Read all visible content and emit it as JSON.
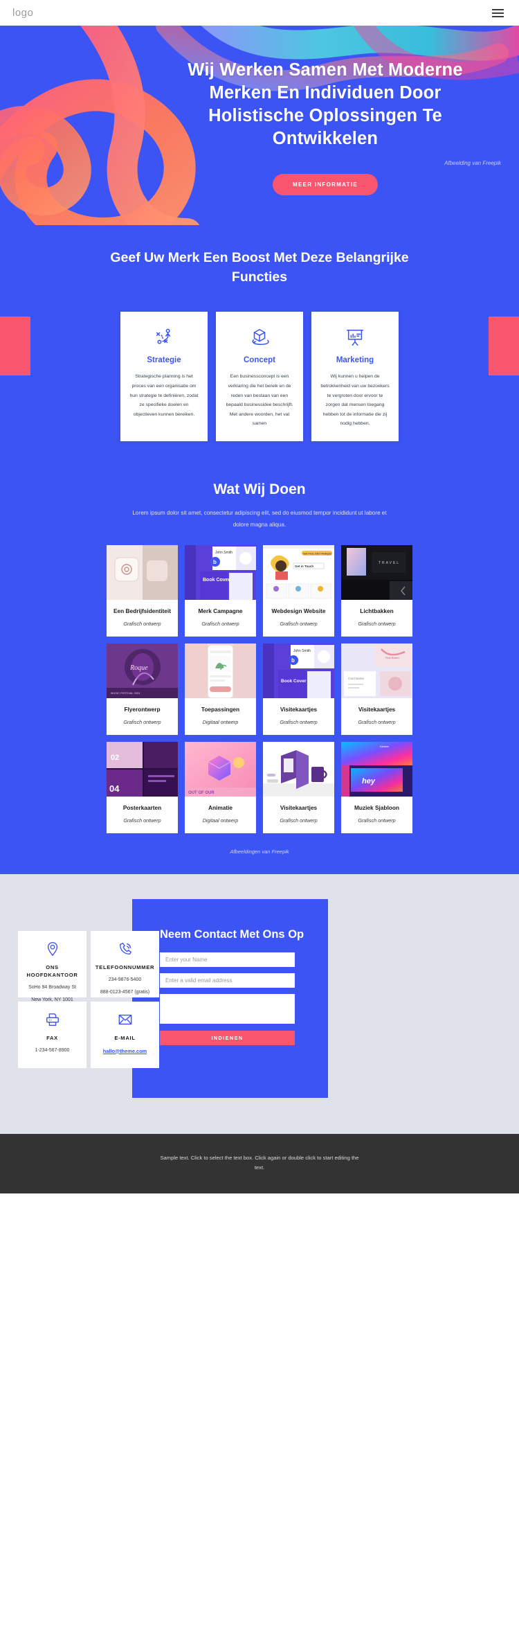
{
  "header": {
    "logo": "logo",
    "menu_icon": "hamburger-menu-icon"
  },
  "hero": {
    "title": "Wij Werken Samen Met Moderne Merken En Individuen Door Holistische Oplossingen Te Ontwikkelen",
    "credit": "Afbeelding van Freepik",
    "cta": "MEER INFORMATIE",
    "bg_color": "#3d54f4",
    "accent_color": "#f8566f"
  },
  "features": {
    "title": "Geef Uw Merk Een Boost Met Deze Belangrijke Functies",
    "cards": [
      {
        "icon": "strategy-icon",
        "name": "Strategie",
        "desc": "Strategische planning is het proces van een organisatie om hun strategie te definiëren, zodat ze specifieke doelen en objectieven kunnen bereiken."
      },
      {
        "icon": "concept-cube-icon",
        "name": "Concept",
        "desc": "Een businessconcept is een verklaring die het bereik en de reden van bestaan van een bepaald businessidee beschrijft. Met andere woorden, het vat samen"
      },
      {
        "icon": "marketing-presentation-icon",
        "name": "Marketing",
        "desc": "Wij kunnen u helpen de betrokkenheid van uw bezoekers te vergroten door ervoor te zorgen dat mensen toegang hebben tot de informatie die zij nodig hebben."
      }
    ]
  },
  "portfolio": {
    "title": "Wat Wij Doen",
    "subtitle": "Lorem ipsum dolor sit amet, consectetur adipiscing elit, sed do eiusmod tempor incididunt ut labore et dolore magna aliqua.",
    "credit": "Afbeeldingen van Freepik",
    "items": [
      {
        "title": "Een Bedrijfsidentiteit",
        "category": "Grafisch ontwerp",
        "thumb": "marble-branding-thumb"
      },
      {
        "title": "Merk Campagne",
        "category": "Grafisch ontwerp",
        "thumb": "book-cover-thumb"
      },
      {
        "title": "Webdesign Website",
        "category": "Grafisch ontwerp",
        "thumb": "seo-landing-page-thumb"
      },
      {
        "title": "Lichtbakken",
        "category": "Grafisch ontwerp",
        "thumb": "lightbox-dark-thumb"
      },
      {
        "title": "Flyerontwerp",
        "category": "Grafisch ontwerp",
        "thumb": "purple-flyer-thumb"
      },
      {
        "title": "Toepassingen",
        "category": "Digitaal ontwerp",
        "thumb": "mobile-app-mockup-thumb"
      },
      {
        "title": "Visitekaartjes",
        "category": "Grafisch ontwerp",
        "thumb": "business-card-book-thumb"
      },
      {
        "title": "Visitekaartjes",
        "category": "Grafisch ontwerp",
        "thumb": "pink-card-set-thumb"
      },
      {
        "title": "Posterkaarten",
        "category": "Grafisch ontwerp",
        "thumb": "poster-cards-thumb"
      },
      {
        "title": "Animatie",
        "category": "Digitaal ontwerp",
        "thumb": "3d-animation-thumb"
      },
      {
        "title": "Visitekaartjes",
        "category": "Grafisch ontwerp",
        "thumb": "desk-calendar-mug-thumb"
      },
      {
        "title": "Muziek Sjabloon",
        "category": "Grafisch ontwerp",
        "thumb": "music-gradient-thumb"
      }
    ]
  },
  "contact": {
    "title": "Neem Contact Met Ons Op",
    "name_placeholder": "Enter your Name",
    "email_placeholder": "Enter a valid email address",
    "message_placeholder": "",
    "submit": "INDIENEN",
    "info": [
      {
        "icon": "location-pin-icon",
        "title": "ONS HOOFDKANTOOR",
        "line1": "SoHo 94 Broadway St",
        "line2": "New York, NY 1001",
        "link": ""
      },
      {
        "icon": "phone-call-icon",
        "title": "TELEFOONNUMMER",
        "line1": "234-9876-5400",
        "line2": "888-0123-4567 (gratis)",
        "link": ""
      },
      {
        "icon": "fax-printer-icon",
        "title": "FAX",
        "line1": "1-234-567-8900",
        "line2": "",
        "link": ""
      },
      {
        "icon": "envelope-mail-icon",
        "title": "E-MAIL",
        "line1": "",
        "line2": "",
        "link": "hallo@theme.com"
      }
    ]
  },
  "footer": {
    "text": "Sample text. Click to select the text box. Click again or double click to start editing the text."
  }
}
